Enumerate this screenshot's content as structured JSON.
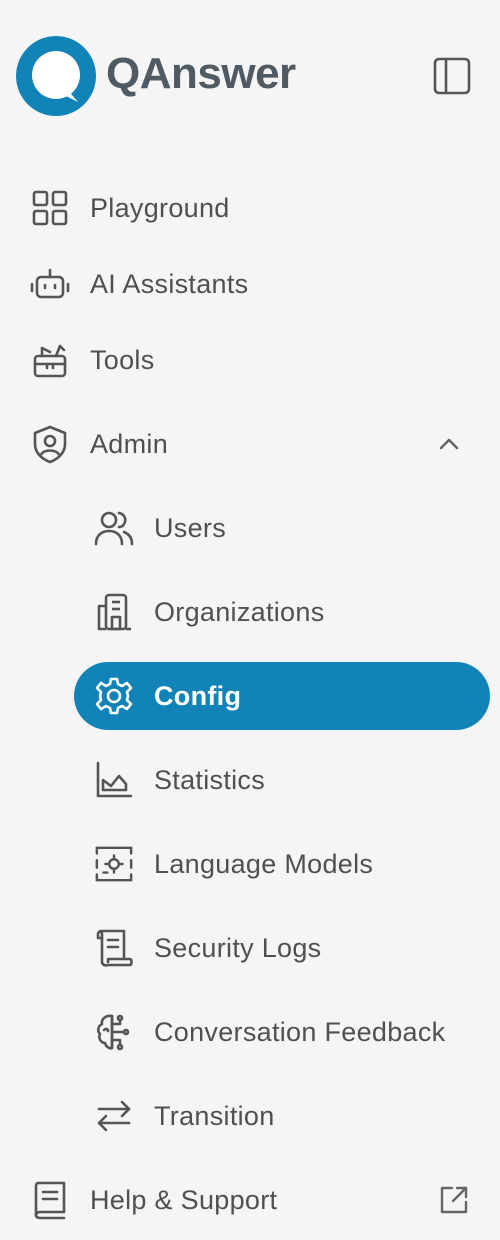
{
  "brand": {
    "name": "QAnswer",
    "accent_color": "#1283b7",
    "text_color": "#4f5a62"
  },
  "nav": {
    "playground": "Playground",
    "ai_assistants": "AI Assistants",
    "tools": "Tools",
    "admin": "Admin",
    "admin_children": {
      "users": "Users",
      "organizations": "Organizations",
      "config": "Config",
      "statistics": "Statistics",
      "language_models": "Language Models",
      "security_logs": "Security Logs",
      "conversation_feedback": "Conversation Feedback",
      "transition": "Transition"
    },
    "help_support": "Help & Support"
  },
  "state": {
    "active_item": "Config",
    "admin_expanded": true
  },
  "icons": {
    "collapse": "sidebar-collapse-icon",
    "playground": "grid-icon",
    "ai_assistants": "robot-icon",
    "tools": "toolbox-icon",
    "admin": "shield-user-icon",
    "users": "users-icon",
    "organizations": "building-icon",
    "config": "gear-icon",
    "statistics": "chart-icon",
    "language_models": "model-chip-icon",
    "security_logs": "scroll-log-icon",
    "conversation_feedback": "brain-icon",
    "transition": "arrows-exchange-icon",
    "help_support": "book-icon",
    "external": "external-link-icon"
  }
}
